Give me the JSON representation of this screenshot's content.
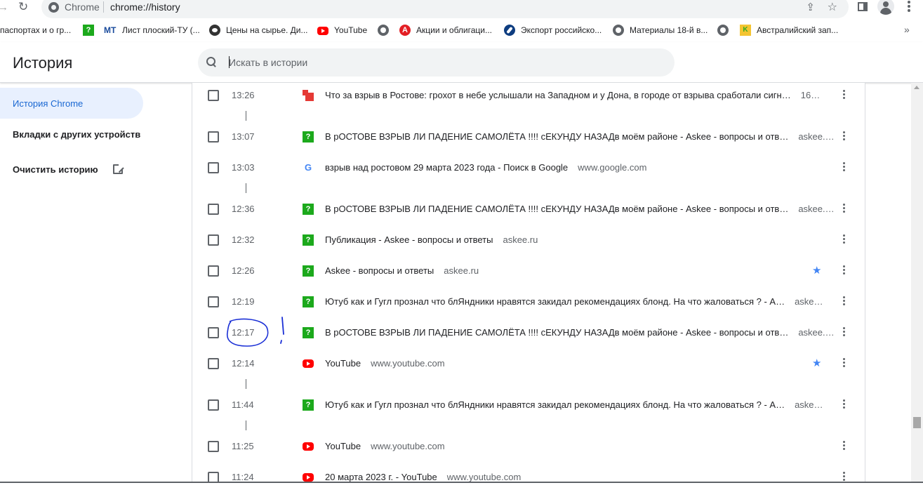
{
  "browser": {
    "site_label": "Chrome",
    "url": "chrome://history",
    "bookmarks": [
      {
        "label": "паспортах и о гр...",
        "icon": "none"
      },
      {
        "label": "Лист плоский-ТУ (...",
        "icon": "mt-logo-icon"
      },
      {
        "label": "Цены на сырье. Ди...",
        "icon": "eye-icon"
      },
      {
        "label": "YouTube",
        "icon": "youtube-icon"
      },
      {
        "label": "Акции и облигаци...",
        "icon": "red-a-icon"
      },
      {
        "label": "Экспорт российско...",
        "icon": "rocket-icon"
      },
      {
        "label": "Материалы 18-й в...",
        "icon": "globe-icon"
      },
      {
        "label": "Австралийский зап...",
        "icon": "kangaroo-icon"
      }
    ],
    "more_label": "»"
  },
  "header": {
    "title": "История",
    "search_placeholder": "Искать в истории"
  },
  "sidebar": {
    "items": [
      {
        "label": "История Chrome",
        "active": true
      },
      {
        "label": "Вкладки с других устройств",
        "active": false
      },
      {
        "label": "Очистить историю",
        "active": false
      }
    ]
  },
  "history": [
    {
      "time": "13:26",
      "favicon": "rostov-icon",
      "title": "Что за взрыв в Ростове: грохот в небе услышали на Западном и у Дона, в городе от взрыва сработали сигн…",
      "domain": "16…",
      "starred": false
    },
    {
      "time": "13:07",
      "favicon": "askee-icon",
      "title": "В рОСТОВЕ ВЗРЫВ ЛИ ПАДЕНИЕ САМОЛЁТА !!!! сЕКУНДУ НАЗАДв моём районе - Askee - вопросы и отв…",
      "domain": "askee.…",
      "starred": false
    },
    {
      "time": "13:03",
      "favicon": "google-icon",
      "title": "взрыв над ростовом 29 марта 2023 года - Поиск в Google",
      "domain": "www.google.com",
      "starred": false
    },
    {
      "time": "12:36",
      "favicon": "askee-icon",
      "title": "В рОСТОВЕ ВЗРЫВ ЛИ ПАДЕНИЕ САМОЛЁТА !!!! сЕКУНДУ НАЗАДв моём районе - Askee - вопросы и отв…",
      "domain": "askee.…",
      "starred": false
    },
    {
      "time": "12:32",
      "favicon": "askee-icon",
      "title": "Публикация - Askee - вопросы и ответы",
      "domain": "askee.ru",
      "starred": false
    },
    {
      "time": "12:26",
      "favicon": "askee-icon",
      "title": "Askee - вопросы и ответы",
      "domain": "askee.ru",
      "starred": true
    },
    {
      "time": "12:19",
      "favicon": "askee-icon",
      "title": "Ютуб как и Гугл прознал что блЯндники нравятся закидал рекомендациях блонд. На что жаловаться ? - А…",
      "domain": "aske…",
      "starred": false
    },
    {
      "time": "12:17",
      "favicon": "askee-icon",
      "title": "В рОСТОВЕ ВЗРЫВ ЛИ ПАДЕНИЕ САМОЛЁТА !!!! сЕКУНДУ НАЗАДв моём районе - Askee - вопросы и отв…",
      "domain": "askee.…",
      "starred": false
    },
    {
      "time": "12:14",
      "favicon": "youtube-icon",
      "title": "YouTube",
      "domain": "www.youtube.com",
      "starred": true
    },
    {
      "time": "11:44",
      "favicon": "askee-icon",
      "title": "Ютуб как и Гугл прознал что блЯндники нравятся закидал рекомендациях блонд. На что жаловаться ? - А…",
      "domain": "aske…",
      "starred": false
    },
    {
      "time": "11:25",
      "favicon": "youtube-icon",
      "title": "YouTube",
      "domain": "www.youtube.com",
      "starred": false
    },
    {
      "time": "11:24",
      "favicon": "youtube-icon",
      "title": "20 марта 2023 г. - YouTube",
      "domain": "www.youtube.com",
      "starred": false
    }
  ],
  "colors": {
    "accent": "#1967d2",
    "active_bg": "#e8f0fe",
    "star": "#4285f4",
    "annotation": "#1a2fd6"
  }
}
